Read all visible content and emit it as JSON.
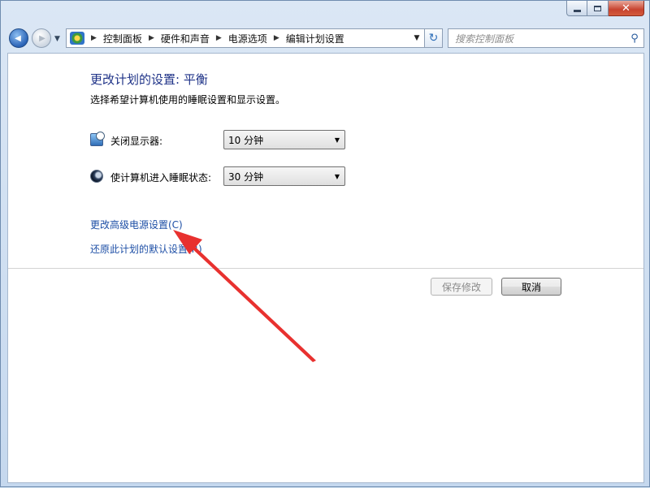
{
  "window": {
    "caption_buttons": {
      "minimize": "minimize-icon",
      "maximize": "maximize-icon",
      "close": "✕"
    }
  },
  "nav": {
    "back_glyph": "◀",
    "forward_glyph": "▶",
    "dropdown_glyph": "▼",
    "breadcrumb": [
      "控制面板",
      "硬件和声音",
      "电源选项",
      "编辑计划设置"
    ],
    "refresh_glyph": "↻",
    "search_placeholder": "搜索控制面板",
    "search_glyph": "🔍"
  },
  "page": {
    "title": "更改计划的设置: 平衡",
    "subtitle": "选择希望计算机使用的睡眠设置和显示设置。",
    "settings": [
      {
        "label": "关闭显示器:",
        "value": "10 分钟",
        "icon": "display-icon"
      },
      {
        "label": "使计算机进入睡眠状态:",
        "value": "30 分钟",
        "icon": "sleep-icon"
      }
    ],
    "links": {
      "advanced": "更改高级电源设置(C)",
      "restore": "还原此计划的默认设置(R)"
    },
    "buttons": {
      "save": "保存修改",
      "cancel": "取消"
    }
  },
  "colors": {
    "annotation_arrow": "#e8312f",
    "title": "#1e3287",
    "link": "#1e4fa6"
  }
}
